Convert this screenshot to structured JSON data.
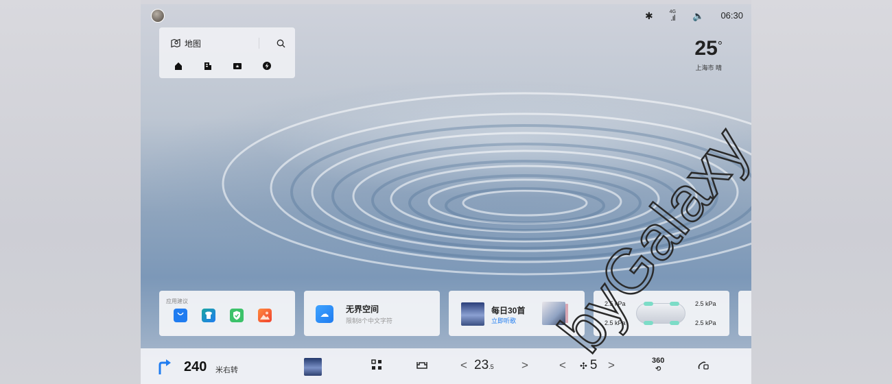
{
  "status_bar": {
    "bluetooth_icon": "bluetooth-icon",
    "network": "4G",
    "volume_icon": "volume-icon",
    "time": "06:30"
  },
  "map_widget": {
    "label": "地图",
    "shortcuts": [
      "home-icon",
      "company-icon",
      "favorite-icon",
      "charging-icon"
    ]
  },
  "weather": {
    "temperature": "25",
    "degree": "°",
    "location": "上海市 晴"
  },
  "app_suggestions": {
    "title": "应用建议",
    "apps": [
      {
        "name": "store-app-icon",
        "color": "#1f7cf0"
      },
      {
        "name": "theme-app-icon",
        "color": "#1aa6a0"
      },
      {
        "name": "security-app-icon",
        "color": "#3cc26a"
      },
      {
        "name": "gallery-app-icon",
        "color": "#f0522f"
      }
    ]
  },
  "cloud_space": {
    "title": "无界空间",
    "subtitle": "限制8个中文字符"
  },
  "music": {
    "title": "每日30首",
    "action": "立即听歌"
  },
  "tire_pressure": {
    "front_left": "2.5 kPa",
    "front_right": "2.5 kPa",
    "rear_left": "2.5 kPa",
    "rear_right": "2.5 kPa"
  },
  "bottom_bar": {
    "distance": "240",
    "instruction": "米右转",
    "temperature": "23",
    "temperature_decimal": ".5",
    "temperature_unit": "°",
    "fan_level": "5",
    "camera_label": "360",
    "left_chevron": "<",
    "right_chevron": ">"
  },
  "watermark": "byGalaxy"
}
